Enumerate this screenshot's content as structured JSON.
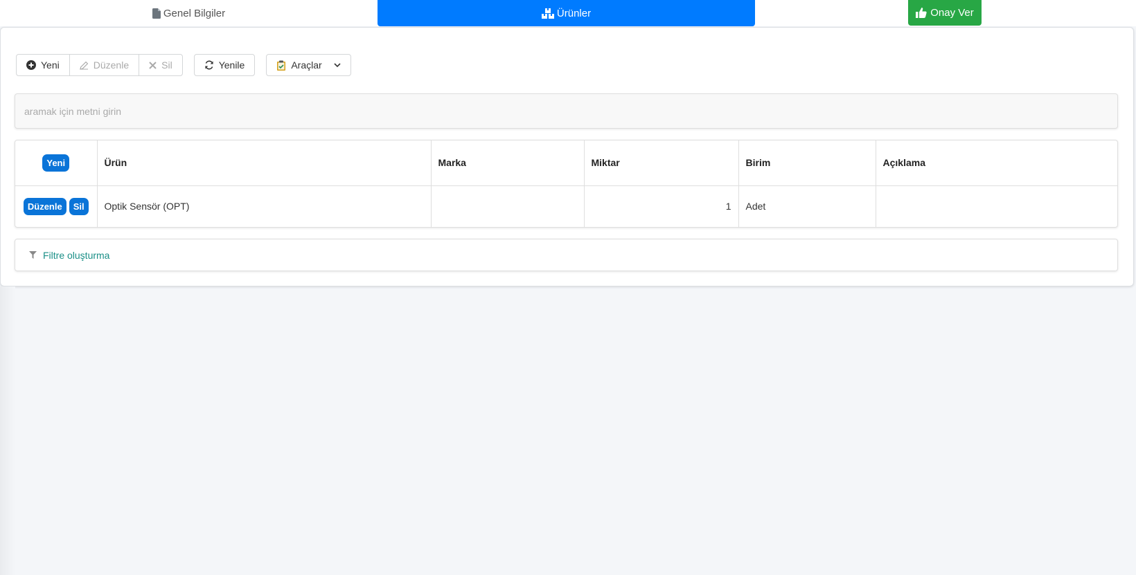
{
  "tabs": {
    "general": {
      "label": "Genel Bilgiler",
      "icon": "file-icon"
    },
    "products": {
      "label": "Ürünler",
      "icon": "boxes-icon"
    }
  },
  "approve": {
    "label": "Onay Ver",
    "icon": "thumbs-up-icon"
  },
  "toolbar": {
    "new_label": "Yeni",
    "edit_label": "Düzenle",
    "delete_label": "Sil",
    "refresh_label": "Yenile",
    "tools_label": "Araçlar"
  },
  "search": {
    "placeholder": "aramak için metni girin",
    "value": ""
  },
  "grid": {
    "header_new_label": "Yeni",
    "columns": [
      "Ürün",
      "Marka",
      "Miktar",
      "Birim",
      "Açıklama"
    ],
    "rows": [
      {
        "edit_label": "Düzenle",
        "delete_label": "Sil",
        "product": "Optik Sensör (OPT)",
        "brand": "",
        "quantity": "1",
        "unit": "Adet",
        "description": ""
      }
    ]
  },
  "filter": {
    "label": "Filtre oluşturma",
    "icon": "filter-icon"
  },
  "colors": {
    "primary": "#007bff",
    "success": "#28a745",
    "pill": "#0a74d8",
    "filter_text": "#1a8f87"
  }
}
